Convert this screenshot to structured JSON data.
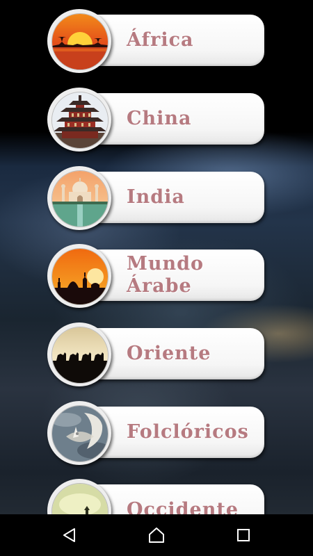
{
  "categories": [
    {
      "label": "África",
      "icon": "africa-sunset-icon"
    },
    {
      "label": "China",
      "icon": "china-pagoda-icon"
    },
    {
      "label": "India",
      "icon": "india-taj-mahal-icon"
    },
    {
      "label": "Mundo\nÁrabe",
      "icon": "arab-mosque-sunset-icon"
    },
    {
      "label": "Oriente",
      "icon": "camel-caravan-icon"
    },
    {
      "label": "Folclóricos",
      "icon": "moon-face-icon"
    },
    {
      "label": "Occidente",
      "icon": "western-landscape-icon"
    }
  ],
  "colors": {
    "label": "#b67a80",
    "pill": "#ffffff",
    "navbar": "#000000"
  },
  "navbar": {
    "back": "back-triangle-icon",
    "home": "home-icon",
    "recents": "recents-square-icon"
  }
}
